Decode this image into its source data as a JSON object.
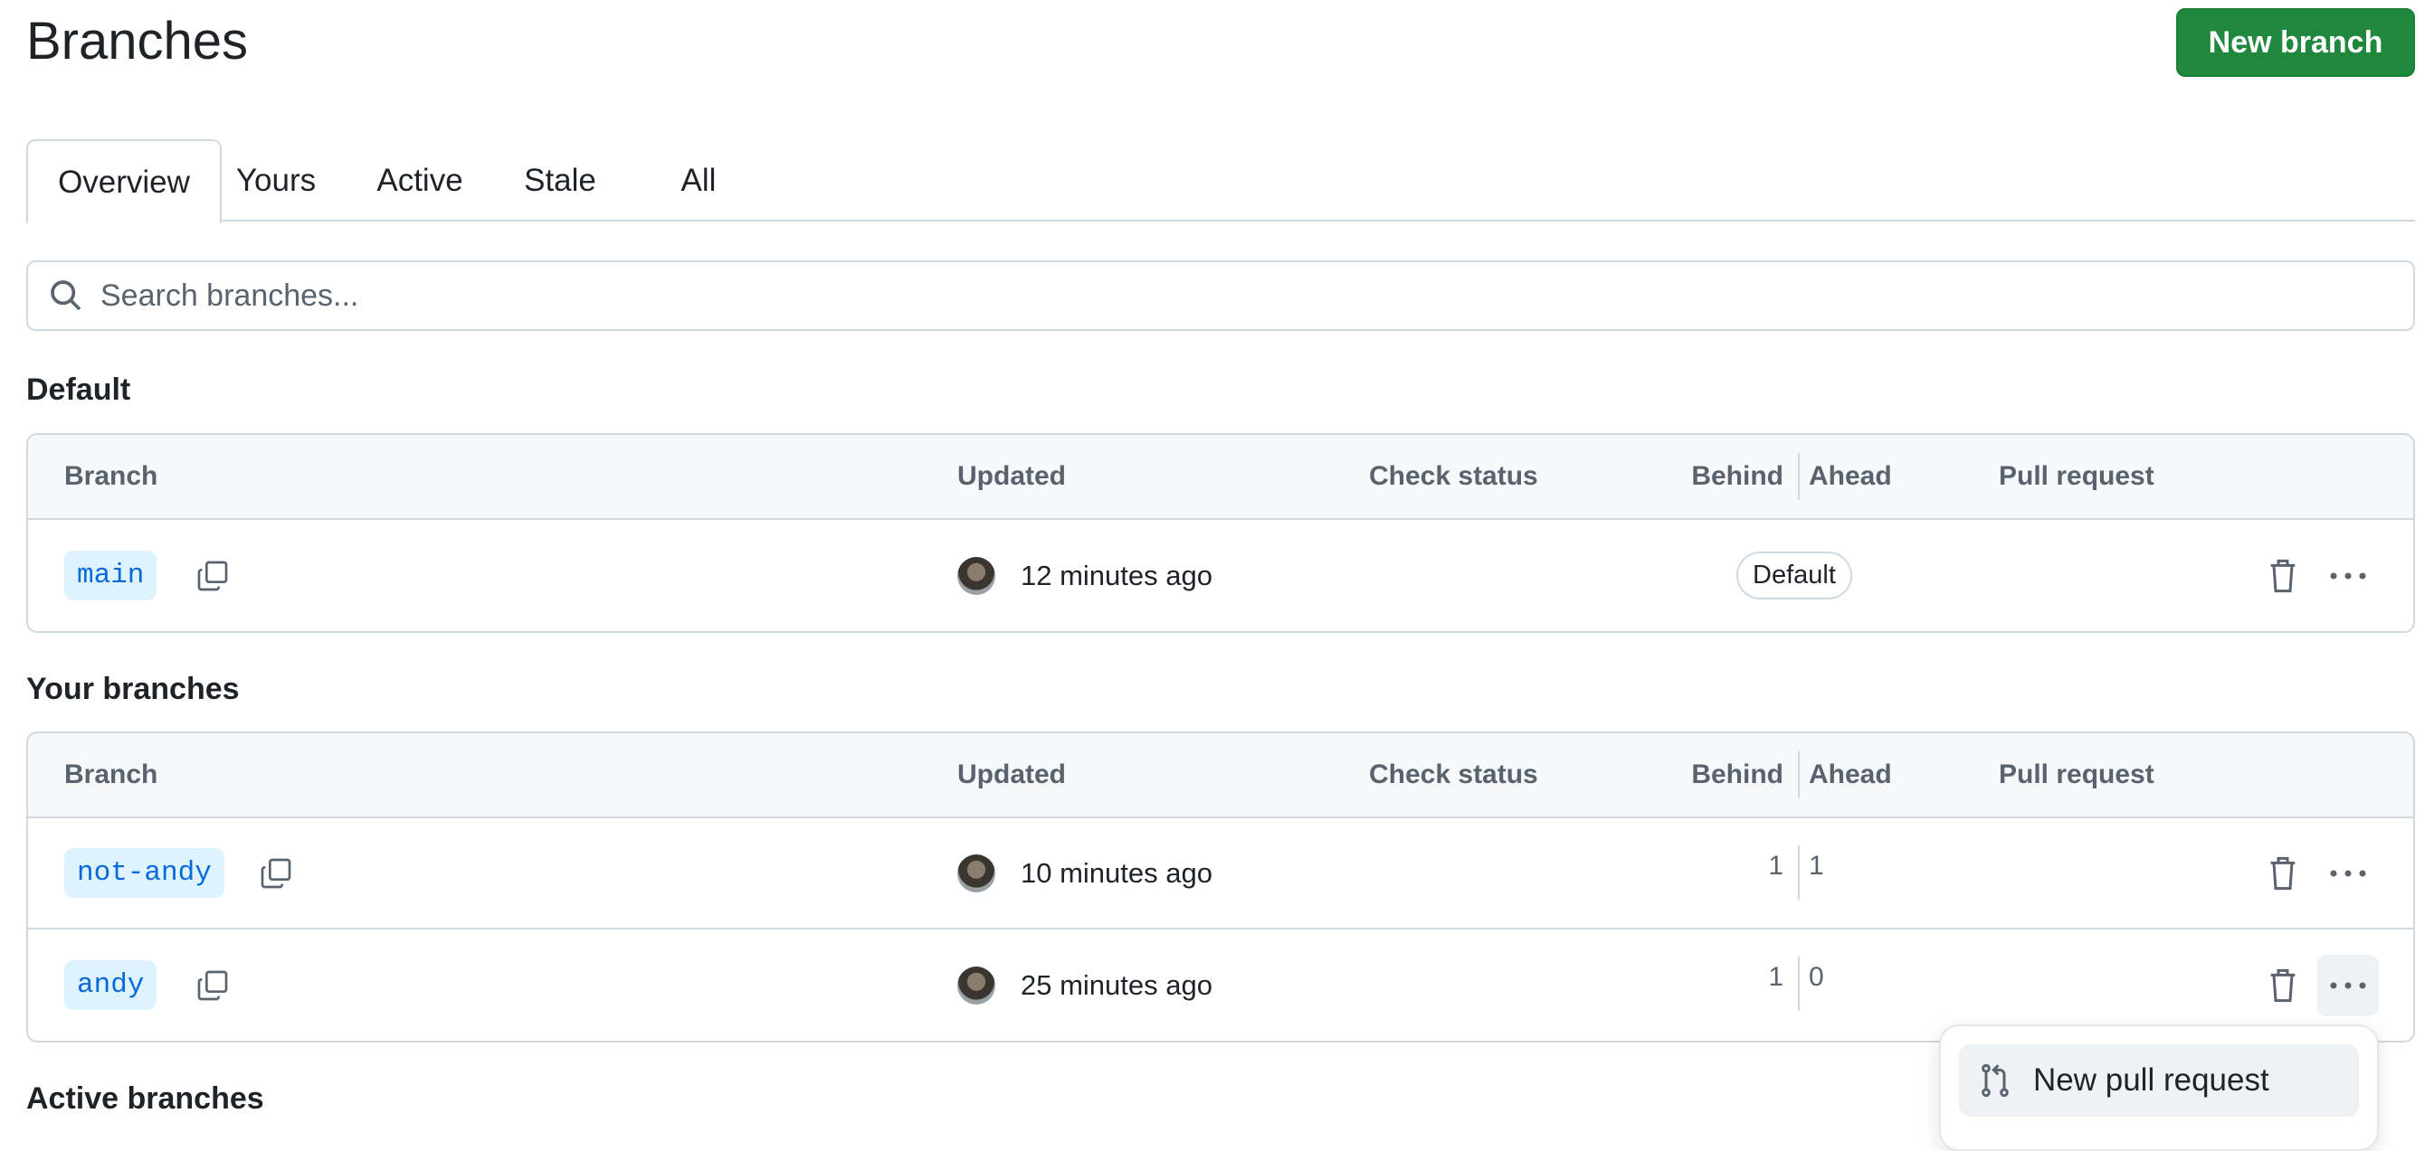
{
  "header": {
    "title": "Branches",
    "new_branch_label": "New branch"
  },
  "tabs": [
    {
      "label": "Overview",
      "selected": true
    },
    {
      "label": "Yours"
    },
    {
      "label": "Active"
    },
    {
      "label": "Stale"
    },
    {
      "label": "All"
    }
  ],
  "search": {
    "placeholder": "Search branches..."
  },
  "columns": {
    "branch": "Branch",
    "updated": "Updated",
    "check_status": "Check status",
    "behind": "Behind",
    "ahead": "Ahead",
    "pull_request": "Pull request"
  },
  "sections": {
    "default": {
      "title": "Default",
      "rows": [
        {
          "branch": "main",
          "updated": "12 minutes ago",
          "badge": "Default"
        }
      ]
    },
    "yours": {
      "title": "Your branches",
      "rows": [
        {
          "branch": "not-andy",
          "updated": "10 minutes ago",
          "behind": "1",
          "ahead": "1"
        },
        {
          "branch": "andy",
          "updated": "25 minutes ago",
          "behind": "1",
          "ahead": "0"
        }
      ]
    },
    "active": {
      "title": "Active branches"
    }
  },
  "menu": {
    "items": [
      {
        "label": "New pull request",
        "icon": "git-pull-request-icon"
      }
    ]
  },
  "colors": {
    "primary": "#1f883d",
    "branch_chip": "#ddf4ff",
    "branch_text": "#0969da"
  }
}
